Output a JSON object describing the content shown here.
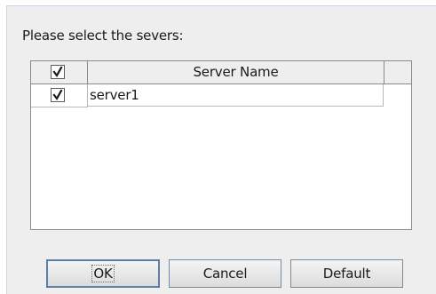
{
  "dialog": {
    "prompt": "Please select the severs:"
  },
  "table": {
    "header_checked": true,
    "columns": [
      "",
      "Server Name"
    ],
    "rows": [
      {
        "checked": true,
        "name": "server1"
      }
    ]
  },
  "buttons": {
    "ok": "OK",
    "cancel": "Cancel",
    "default": "Default"
  },
  "icons": {
    "checkbox": "checkmark-icon"
  },
  "colors": {
    "background": "#eeeeee",
    "table_background": "#ffffff",
    "focus_border": "#5f7ea6"
  }
}
